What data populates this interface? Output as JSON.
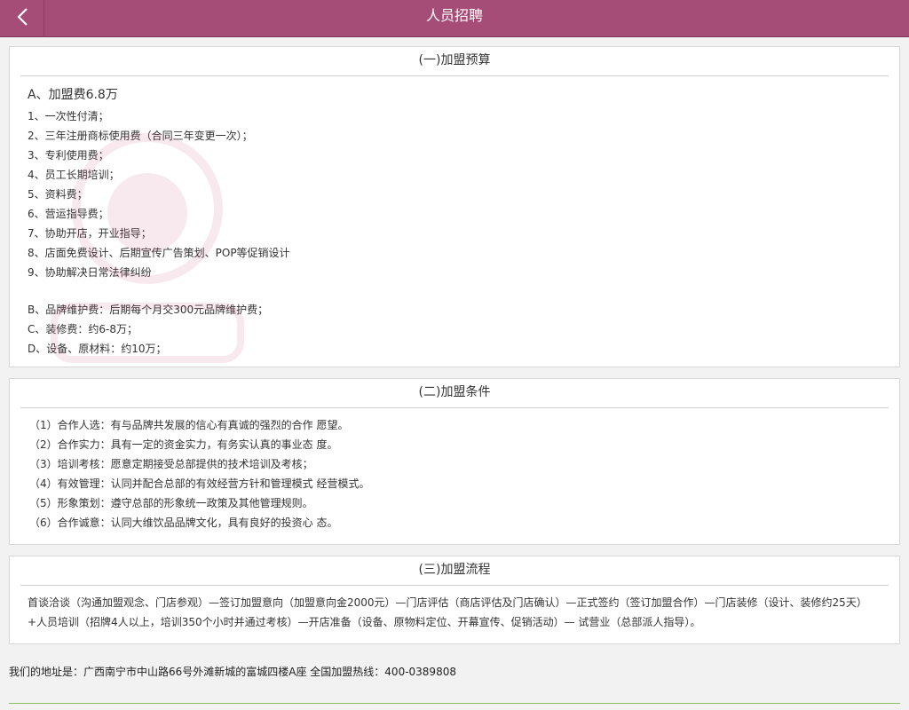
{
  "header": {
    "title": "人员招聘",
    "back_icon": "chevron-left-icon"
  },
  "budget": {
    "title": "(一)加盟预算",
    "fee_heading": "A、加盟费6.8万",
    "items": [
      "1、一次性付清；",
      "2、三年注册商标使用费（合同三年变更一次）；",
      "3、专利使用费；",
      "4、员工长期培训；",
      "5、资料费；",
      "6、营运指导费；",
      "7、协助开店，开业指导；",
      "8、店面免费设计、后期宣传广告策划、POP等促销设计",
      "9、协助解决日常法律纠纷"
    ],
    "extra": [
      "B、品牌维护费：后期每个月交300元品牌维护费；",
      "C、装修费：约6-8万；",
      "D、设备、原材料：约10万；"
    ]
  },
  "conditions": {
    "title": "(二)加盟条件",
    "items": [
      "（1）合作人选：有与品牌共发展的信心有真诚的强烈的合作 愿望。",
      "（2）合作实力：具有一定的资金实力，有务实认真的事业态 度。",
      "（3）培训考核：愿意定期接受总部提供的技术培训及考核；",
      "（4）有效管理：认同并配合总部的有效经营方针和管理模式 经营模式。",
      "（5）形象策划：遵守总部的形象统一政策及其他管理规则。",
      "（6）合作诚意：认同大维饮品品牌文化，具有良好的投资心 态。"
    ]
  },
  "process": {
    "title": "(三)加盟流程",
    "text": "首谈洽谈（沟通加盟观念、门店参观）—签订加盟意向（加盟意向金2000元）—门店评估（商店评估及门店确认）—正式签约（签订加盟合作）—门店装修（设计、装修约25天）+人员培训（招牌4人以上，培训350个小时并通过考核）—开店准备（设备、原物料定位、开幕宣传、促销活动）— 试营业（总部派人指导）。"
  },
  "footer": {
    "text": "我们的地址是：广西南宁市中山路66号外滩新城的富城四楼A座 全国加盟热线：400-0389808"
  },
  "colors": {
    "header_bg": "#a64d77",
    "footer_line": "#8bbf6a"
  }
}
